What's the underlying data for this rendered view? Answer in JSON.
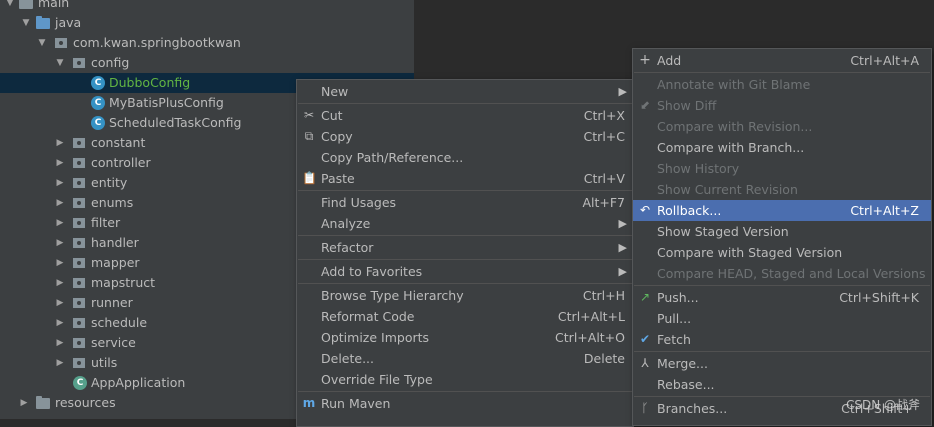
{
  "tree": {
    "rows": [
      {
        "label": "main",
        "icon": "folder-icon"
      },
      {
        "label": "java",
        "icon": "source-folder-icon"
      },
      {
        "label": "com.kwan.springbootkwan",
        "icon": "package-icon"
      },
      {
        "label": "config",
        "icon": "package-icon"
      },
      {
        "label": "DubboConfig",
        "icon": "class-icon",
        "badge": "C"
      },
      {
        "label": "MyBatisPlusConfig",
        "icon": "class-icon",
        "badge": "C"
      },
      {
        "label": "ScheduledTaskConfig",
        "icon": "class-icon",
        "badge": "C"
      },
      {
        "label": "constant",
        "icon": "package-icon"
      },
      {
        "label": "controller",
        "icon": "package-icon"
      },
      {
        "label": "entity",
        "icon": "package-icon"
      },
      {
        "label": "enums",
        "icon": "package-icon"
      },
      {
        "label": "filter",
        "icon": "package-icon"
      },
      {
        "label": "handler",
        "icon": "package-icon"
      },
      {
        "label": "mapper",
        "icon": "package-icon"
      },
      {
        "label": "mapstruct",
        "icon": "package-icon"
      },
      {
        "label": "runner",
        "icon": "package-icon"
      },
      {
        "label": "schedule",
        "icon": "package-icon"
      },
      {
        "label": "service",
        "icon": "package-icon"
      },
      {
        "label": "utils",
        "icon": "package-icon"
      },
      {
        "label": "AppApplication",
        "icon": "spring-app-icon",
        "badge": "C"
      },
      {
        "label": "resources",
        "icon": "resources-folder-icon"
      }
    ]
  },
  "context_menu": {
    "new": "New",
    "cut": "Cut",
    "cut_sc": "Ctrl+X",
    "copy": "Copy",
    "copy_sc": "Ctrl+C",
    "copy_path": "Copy Path/Reference...",
    "paste": "Paste",
    "paste_sc": "Ctrl+V",
    "find_usages": "Find Usages",
    "find_usages_sc": "Alt+F7",
    "analyze": "Analyze",
    "refactor": "Refactor",
    "add_fav": "Add to Favorites",
    "browse_hier": "Browse Type Hierarchy",
    "browse_hier_sc": "Ctrl+H",
    "reformat": "Reformat Code",
    "reformat_sc": "Ctrl+Alt+L",
    "optimize": "Optimize Imports",
    "optimize_sc": "Ctrl+Alt+O",
    "delete": "Delete...",
    "delete_sc": "Delete",
    "override": "Override File Type",
    "run_maven": "Run Maven"
  },
  "vcs_menu": {
    "add": "Add",
    "add_sc": "Ctrl+Alt+A",
    "annotate": "Annotate with Git Blame",
    "show_diff": "Show Diff",
    "cmp_rev": "Compare with Revision...",
    "cmp_branch": "Compare with Branch...",
    "show_history": "Show History",
    "show_cur_rev": "Show Current Revision",
    "rollback": "Rollback...",
    "rollback_sc": "Ctrl+Alt+Z",
    "show_staged": "Show Staged Version",
    "cmp_staged": "Compare with Staged Version",
    "cmp_head": "Compare HEAD, Staged and Local Versions",
    "push": "Push...",
    "push_sc": "Ctrl+Shift+K",
    "pull": "Pull...",
    "fetch": "Fetch",
    "merge": "Merge...",
    "rebase": "Rebase...",
    "branches": "Branches...",
    "branches_sc": "Ctrl+Shift+`"
  },
  "watermark": "CSDN @战斧",
  "colors": {
    "highlight": "#4b6eaf",
    "panel": "#3c3f41",
    "editor": "#2b2b2b",
    "selected_row": "#0d293e"
  }
}
